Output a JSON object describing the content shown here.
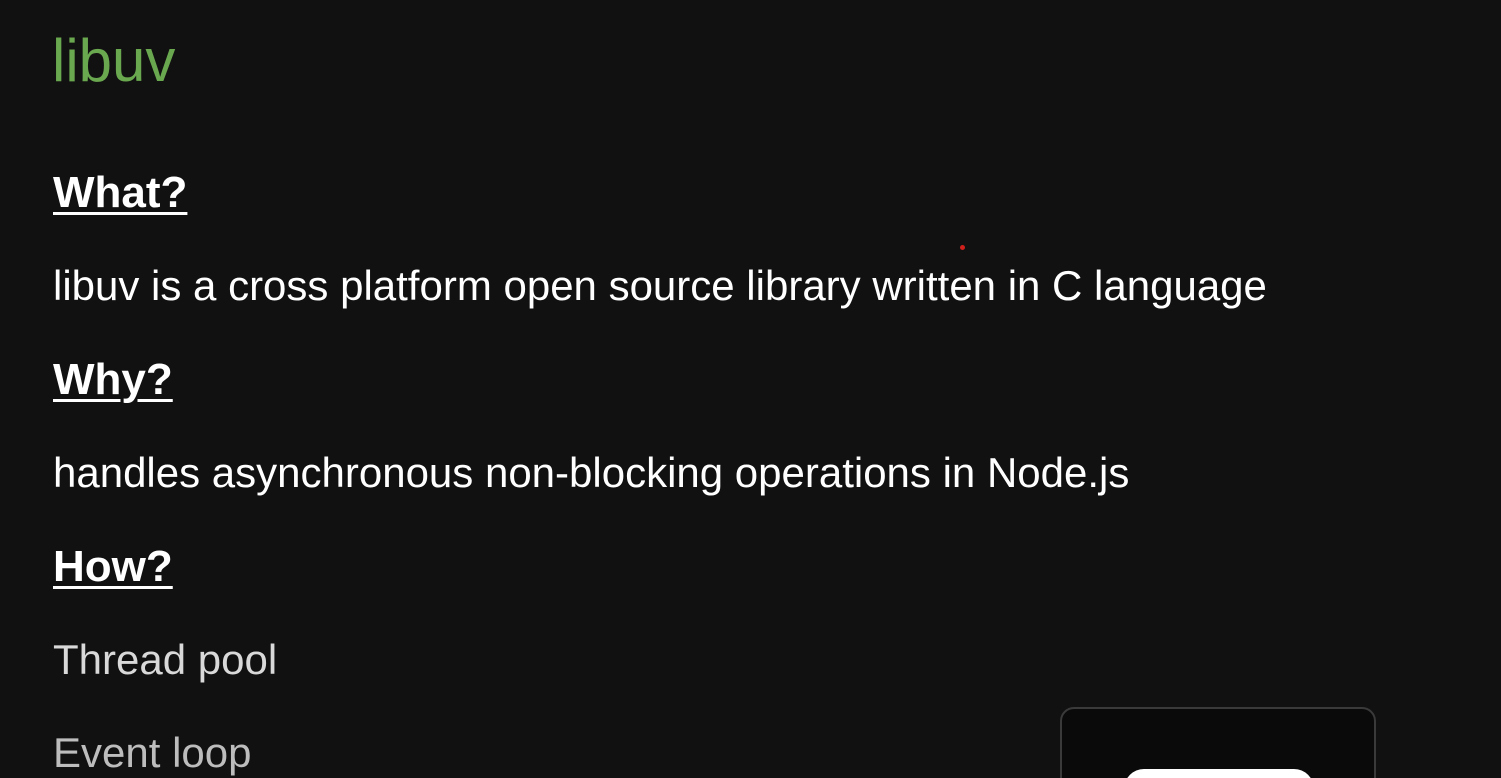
{
  "slide": {
    "title": "libuv",
    "sections": {
      "what": {
        "heading": "What?",
        "text": "libuv is a cross platform open source library written in C language"
      },
      "why": {
        "heading": "Why?",
        "text": "handles asynchronous non-blocking operations in Node.js"
      },
      "how": {
        "heading": "How?",
        "items": [
          "Thread pool",
          "Event loop"
        ]
      }
    }
  },
  "colors": {
    "background": "#111111",
    "title": "#6aa84f",
    "text": "#ffffff",
    "pointer_dot": "#d0201c"
  }
}
